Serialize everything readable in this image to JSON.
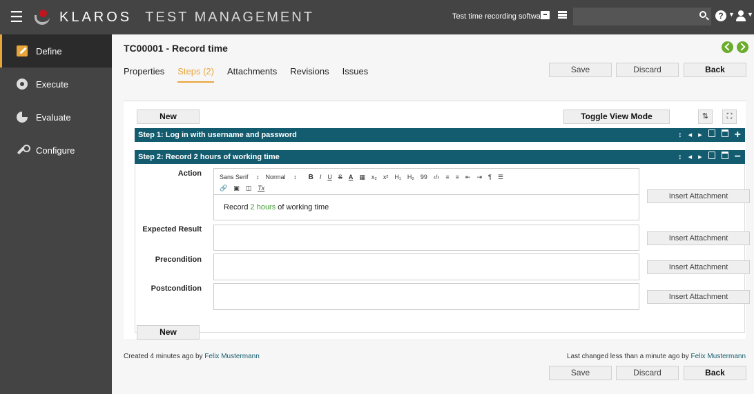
{
  "topbar": {
    "brand_main": "KLAROS",
    "brand_sub": "TEST MANAGEMENT",
    "project": "Test time recording software",
    "search_value": "",
    "search_placeholder": ""
  },
  "sidebar": {
    "items": [
      {
        "label": "Define",
        "icon": "pencil-square-icon",
        "active": true
      },
      {
        "label": "Execute",
        "icon": "gear-icon"
      },
      {
        "label": "Evaluate",
        "icon": "pie-chart-icon"
      },
      {
        "label": "Configure",
        "icon": "wrench-icon"
      }
    ]
  },
  "page": {
    "title": "TC00001 - Record time",
    "save": "Save",
    "discard": "Discard",
    "back": "Back"
  },
  "tabs": [
    {
      "label": "Properties"
    },
    {
      "label": "Steps (2)",
      "active": true
    },
    {
      "label": "Attachments"
    },
    {
      "label": "Revisions"
    },
    {
      "label": "Issues"
    }
  ],
  "steps_panel": {
    "new_label": "New",
    "toggle_view": "Toggle View Mode",
    "step1": "Step 1: Log in with username and password",
    "step2": "Step 2: Record 2 hours of working time",
    "fields": {
      "action": "Action",
      "expected": "Expected Result",
      "precondition": "Precondition",
      "postcondition": "Postcondition"
    },
    "insert_attachment": "Insert Attachment",
    "editor": {
      "font": "Sans Serif",
      "size": "Normal",
      "bold": "B",
      "italic": "I",
      "underline": "U",
      "strike": "S",
      "color": "A",
      "sub": "x₂",
      "sup": "x²",
      "h1": "H₁",
      "h2": "H₂",
      "quote": "99",
      "code": "‹/›",
      "clear": "Tx"
    },
    "action_text_pre": "Record ",
    "action_text_hl": "2 hours",
    "action_text_post": " of working time"
  },
  "footer": {
    "created": "Created 4 minutes ago by ",
    "created_user": "Felix Mustermann",
    "changed": "Last changed less than a minute ago by ",
    "changed_user": "Felix Mustermann"
  },
  "colors": {
    "accent": "#e8a53a",
    "step_bar": "#135b6e",
    "nav_green": "#6aac2b",
    "chrome": "#444444"
  }
}
